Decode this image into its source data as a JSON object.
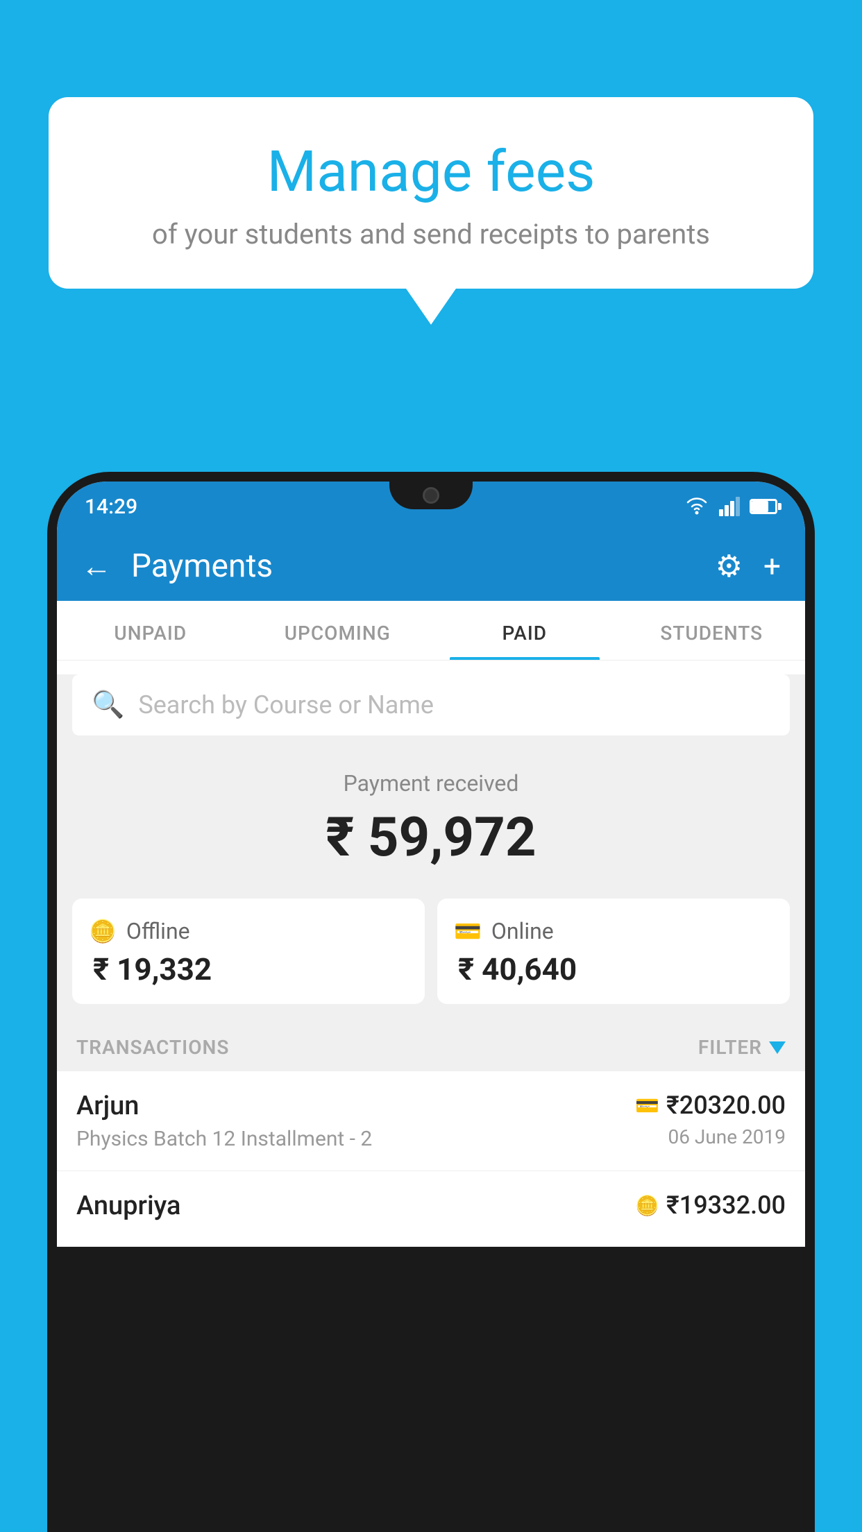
{
  "background": {
    "color": "#1ab0e8"
  },
  "speech_bubble": {
    "title": "Manage fees",
    "subtitle": "of your students and send receipts to parents"
  },
  "phone": {
    "status_bar": {
      "time": "14:29"
    },
    "header": {
      "title": "Payments",
      "back_label": "←",
      "gear_label": "⚙",
      "plus_label": "+"
    },
    "tabs": [
      {
        "label": "UNPAID",
        "active": false
      },
      {
        "label": "UPCOMING",
        "active": false
      },
      {
        "label": "PAID",
        "active": true
      },
      {
        "label": "STUDENTS",
        "active": false
      }
    ],
    "search": {
      "placeholder": "Search by Course or Name"
    },
    "payment_summary": {
      "label": "Payment received",
      "amount": "₹ 59,972",
      "offline_label": "Offline",
      "offline_amount": "₹ 19,332",
      "online_label": "Online",
      "online_amount": "₹ 40,640"
    },
    "transactions": {
      "header_label": "TRANSACTIONS",
      "filter_label": "FILTER",
      "items": [
        {
          "name": "Arjun",
          "description": "Physics Batch 12 Installment - 2",
          "amount": "₹20320.00",
          "date": "06 June 2019",
          "payment_type": "online"
        },
        {
          "name": "Anupriya",
          "description": "",
          "amount": "₹19332.00",
          "date": "",
          "payment_type": "offline"
        }
      ]
    }
  }
}
